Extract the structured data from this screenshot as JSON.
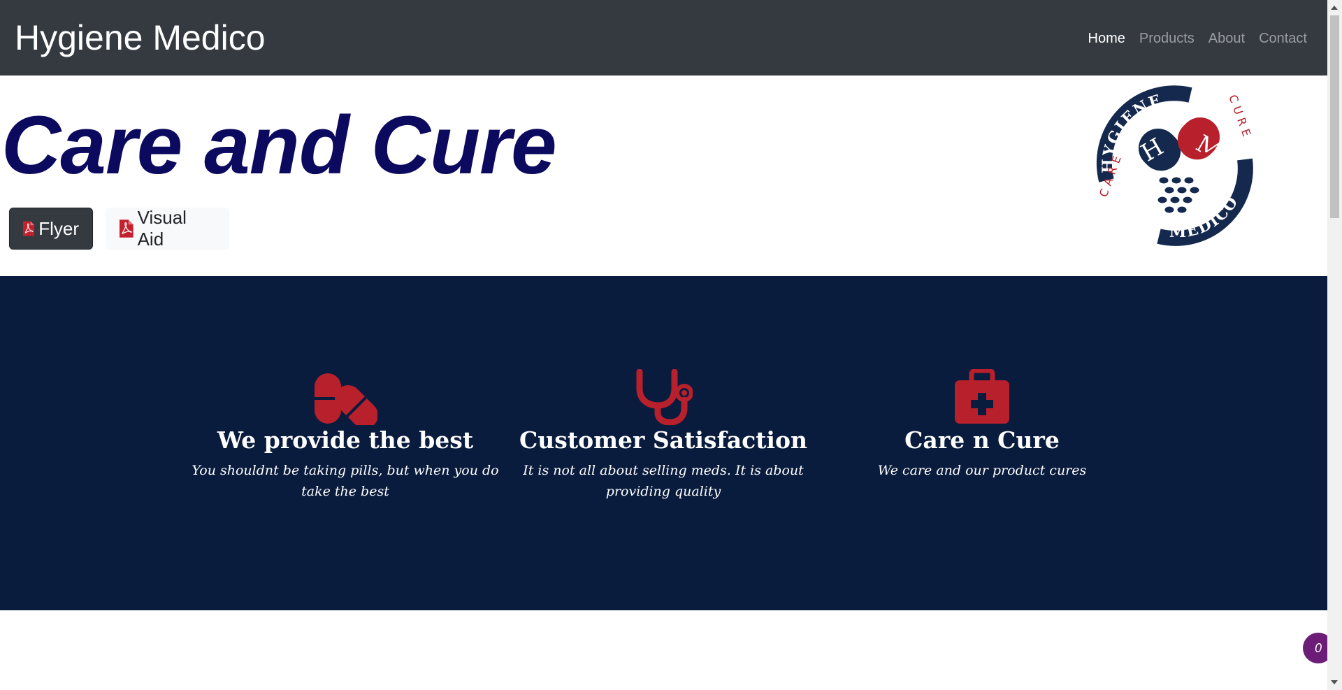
{
  "navbar": {
    "brand": "Hygiene Medico",
    "links": [
      {
        "label": "Home",
        "active": true
      },
      {
        "label": "Products",
        "active": false
      },
      {
        "label": "About",
        "active": false
      },
      {
        "label": "Contact",
        "active": false
      }
    ]
  },
  "hero": {
    "title": "Care and Cure",
    "buttons": {
      "flyer": "Flyer",
      "visual_aid": "Visual Aid"
    },
    "logo": {
      "ring_top": "HYGIENE",
      "ring_bottom": "MEDICO",
      "letters_left": "H",
      "letters_right": "M",
      "care": "CARE",
      "cure": "CURE"
    }
  },
  "features": [
    {
      "icon": "pills-icon",
      "title": "We provide the best",
      "text": "You shouldnt be taking pills, but when you do take the best"
    },
    {
      "icon": "stethoscope-icon",
      "title": "Customer Satisfaction",
      "text": "It is not all about selling meds. It is about providing quality"
    },
    {
      "icon": "medkit-icon",
      "title": "Care n Cure",
      "text": "We care and our product cures"
    }
  ],
  "badge": {
    "value": "0"
  },
  "colors": {
    "navbar": "#343a40",
    "hero_title": "#0c0a5e",
    "features_bg": "#0a1c3d",
    "accent_red": "#b8202c",
    "badge": "#6b1d78"
  }
}
